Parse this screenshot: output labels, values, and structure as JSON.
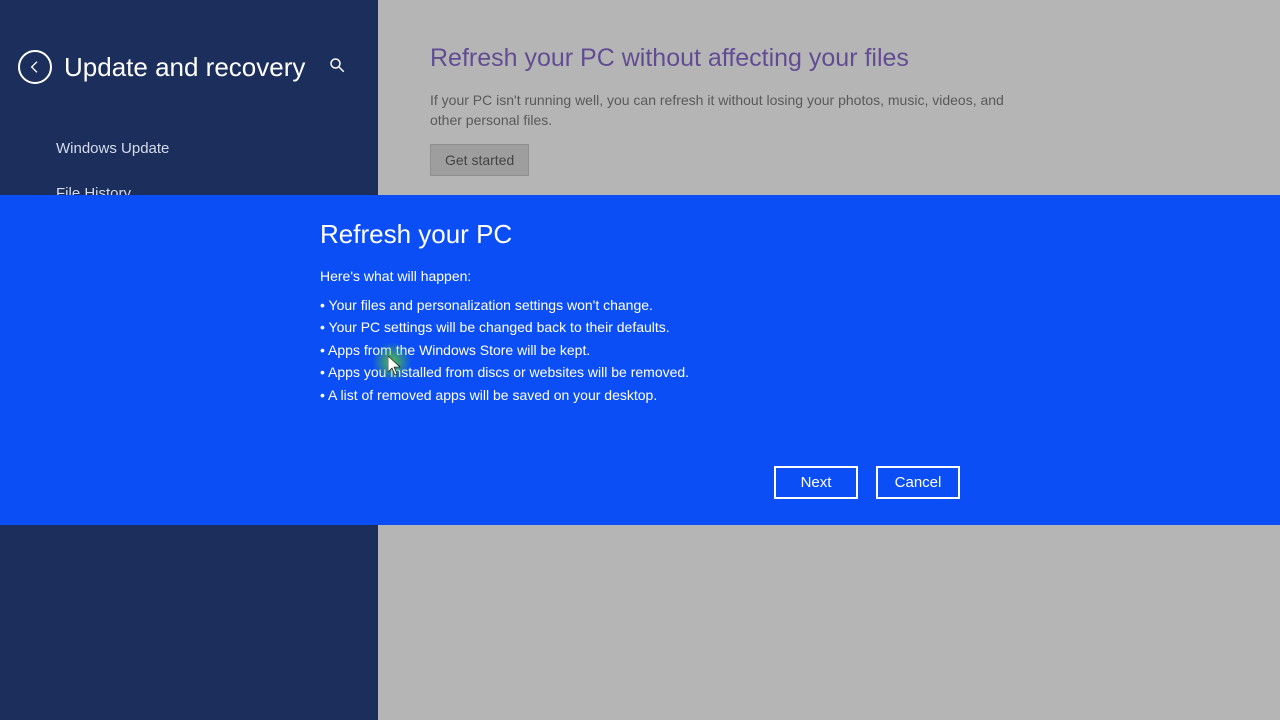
{
  "sidebar": {
    "title": "Update and recovery",
    "nav": [
      {
        "label": "Windows Update"
      },
      {
        "label": "File History"
      }
    ]
  },
  "main": {
    "refresh": {
      "heading": "Refresh your PC without affecting your files",
      "desc": "If your PC isn't running well, you can refresh it without losing your photos, music, videos, and other personal files.",
      "button": "Get started"
    }
  },
  "modal": {
    "title": "Refresh your PC",
    "sub": "Here's what will happen:",
    "items": [
      "Your files and personalization settings won't change.",
      "Your PC settings will be changed back to their defaults.",
      "Apps from the Windows Store will be kept.",
      "Apps you installed from discs or websites will be removed.",
      "A list of removed apps will be saved on your desktop."
    ],
    "next": "Next",
    "cancel": "Cancel"
  }
}
